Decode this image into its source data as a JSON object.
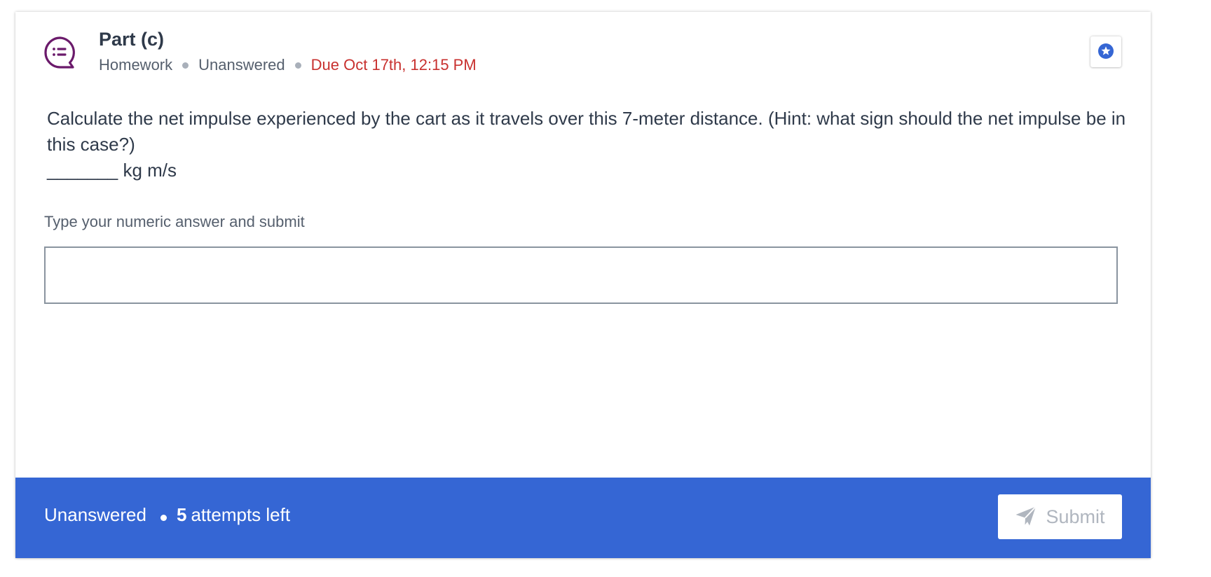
{
  "header": {
    "title": "Part (c)",
    "type": "Homework",
    "status": "Unanswered",
    "due": "Due Oct 17th, 12:15 PM",
    "icon": "question-list-chat-icon",
    "star_icon": "star-badge-icon"
  },
  "question": {
    "line1": "Calculate the net impulse experienced by the cart as it travels over this 7-meter distance. (Hint: what sign should the net impulse be in this case?)",
    "blank": "_______",
    "unit": "kg m/s"
  },
  "answer": {
    "label": "Type your numeric answer and submit",
    "value": "",
    "placeholder": ""
  },
  "footer": {
    "status": "Unanswered",
    "attempts_count": "5",
    "attempts_suffix": "attempts left",
    "submit_label": "Submit",
    "submit_icon": "paper-plane-icon"
  },
  "colors": {
    "accent": "#3566d4",
    "due": "#c8312f",
    "icon_purple": "#6b1a6b",
    "text": "#2f3a4a",
    "muted": "#555f6d",
    "disabled": "#b0b6bf"
  }
}
